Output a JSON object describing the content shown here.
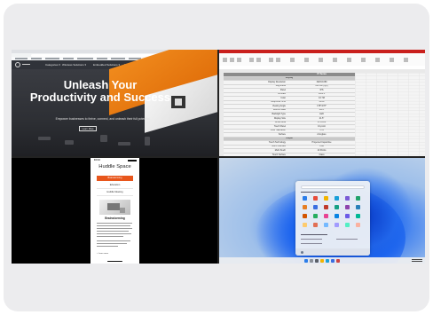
{
  "browser": {
    "nav_items": [
      "Categories ▾",
      "Wireless Solutions ▾",
      "Embedded Solutions ▾",
      "Solutions ▾",
      "Resources ▾",
      "Support ▾"
    ],
    "hero_title": "Unleash Your Productivity and Success",
    "hero_subtitle": "Empower businesses to thrive, connect, and unleash their full potential.",
    "hero_button": "Learn More"
  },
  "spreadsheet": {
    "header_col2": "CT Series",
    "sections": [
      "Display",
      "Output",
      "Speaker, Camera and Microphone"
    ],
    "rows_display": [
      [
        "Display Resolution",
        "1920×1080"
      ],
      [
        "Brightness",
        "350 nits (typ.)"
      ],
      [
        "Panel",
        "IPS"
      ],
      [
        "Contrast",
        "1000:1"
      ],
      [
        "Color",
        "16.7M"
      ],
      [
        "Response Time",
        "25ms"
      ],
      [
        "Viewing Angle",
        "178°/178°"
      ],
      [
        "Refresh Rate",
        "60Hz"
      ],
      [
        "Backlight Type",
        "LED"
      ],
      [
        "Display Size",
        "21.5\""
      ],
      [
        "Active Area",
        "476×268"
      ],
      [
        "Touch Panel",
        "10-point"
      ],
      [
        "Color Saturation",
        "72%"
      ],
      [
        "Surface",
        "Anti-glare"
      ]
    ],
    "rows_output": [
      [
        "Touch Technology",
        "Projected Capacitive"
      ],
      [
        "Touch Interface",
        "USB"
      ],
      [
        "Multi-Touch",
        "10 Points"
      ],
      [
        "Touch Surface",
        "Glass"
      ]
    ],
    "rows_speaker": [
      [
        "Speaker / Video",
        "2W×2"
      ]
    ]
  },
  "phone": {
    "time": "10:14",
    "brand": "Huddle Space",
    "menu": [
      "Brainstorming",
      "Education",
      "Huddle Meeting"
    ],
    "section_title": "Brainstorming",
    "link": "> Learn more"
  }
}
